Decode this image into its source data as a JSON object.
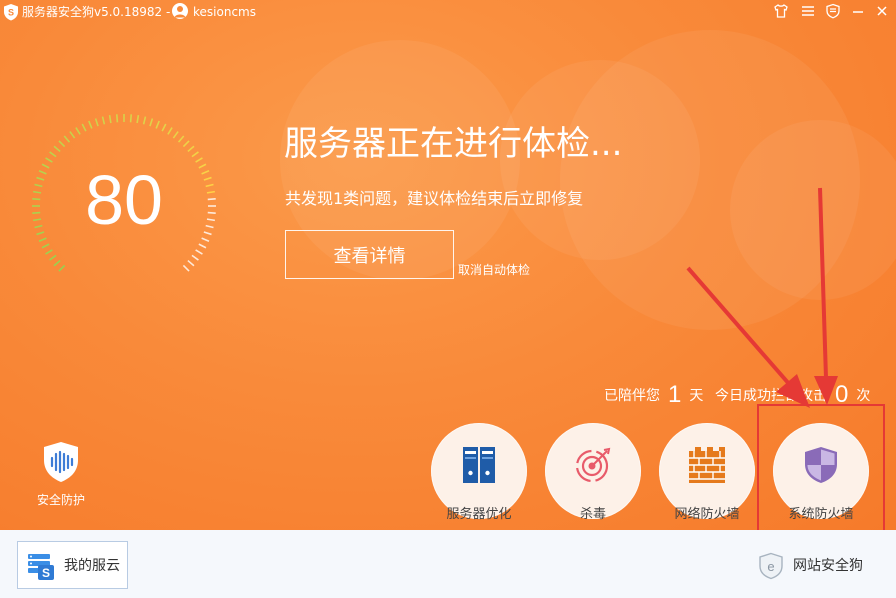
{
  "titlebar": {
    "app_title": "服务器安全狗v5.0.18982 -",
    "user_name": "kesioncms",
    "icons": [
      "shirt-icon",
      "menu-icon",
      "shield-small-icon",
      "minimize-icon",
      "close-icon"
    ]
  },
  "scan": {
    "score": "80",
    "headline": "服务器正在进行体检...",
    "subline": "共发现1类问题，建议体检结束后立即修复",
    "details_button": "查看详情",
    "cancel_link": "取消自动体检"
  },
  "stats": {
    "days_label": "已陪伴您",
    "days_value": "1",
    "days_unit": "天",
    "blocks_label": "今日成功拦截攻击",
    "blocks_value": "0",
    "blocks_unit": "次"
  },
  "protect": {
    "label": "安全防护"
  },
  "tools": [
    {
      "label": "服务器优化",
      "icon": "server-binders-icon"
    },
    {
      "label": "杀毒",
      "icon": "target-scan-icon"
    },
    {
      "label": "网络防火墙",
      "icon": "brick-wall-icon"
    },
    {
      "label": "系统防火墙",
      "icon": "shield-checker-icon"
    }
  ],
  "footer": {
    "cloud_label": "我的服云",
    "site_guard_label": "网站安全狗"
  },
  "colors": {
    "hero_orange": "#f98a3a",
    "footer_bg": "#f5f8fc",
    "highlight_red": "#e53935"
  }
}
